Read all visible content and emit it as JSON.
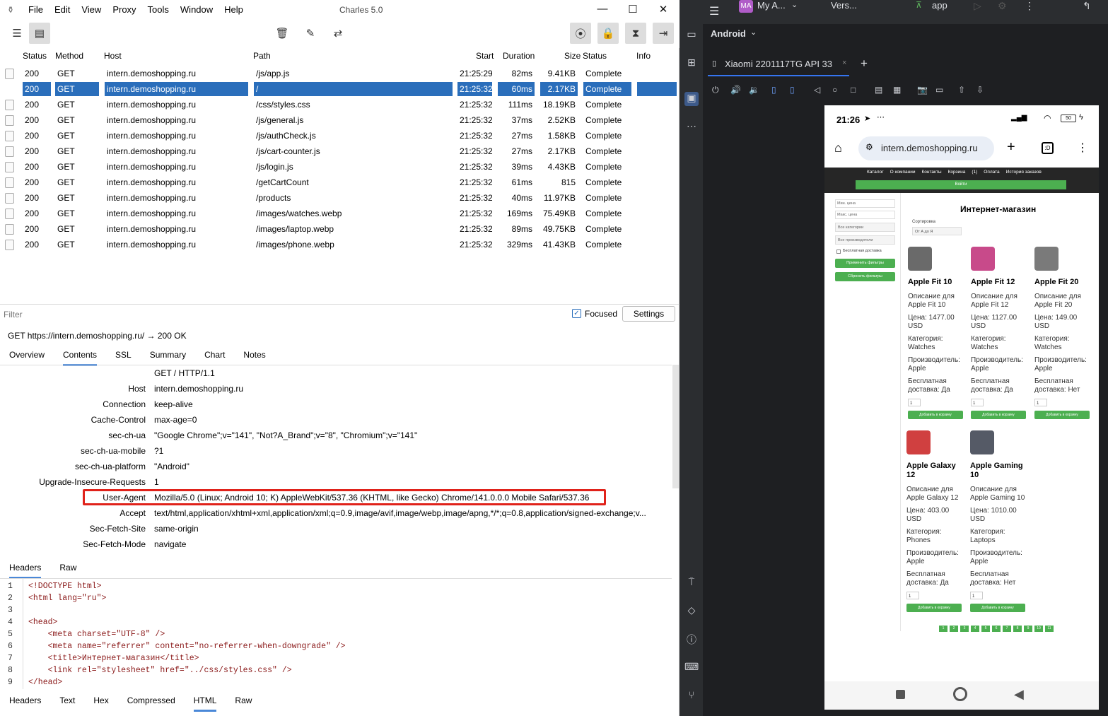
{
  "app": {
    "title": "Charles 5.0",
    "menus": [
      "File",
      "Edit",
      "View",
      "Proxy",
      "Tools",
      "Window",
      "Help"
    ]
  },
  "columns": [
    "Status",
    "Method",
    "Host",
    "Path",
    "Start",
    "Duration",
    "Size",
    "Status",
    "Info"
  ],
  "rows": [
    {
      "status": "200",
      "method": "GET",
      "host": "intern.demoshopping.ru",
      "path": "/js/app.js",
      "start": "21:25:29",
      "duration": "82ms",
      "size": "9.41KB",
      "state": "Complete",
      "icon": "js-file-icon"
    },
    {
      "status": "200",
      "method": "GET",
      "host": "intern.demoshopping.ru",
      "path": "/",
      "start": "21:25:32",
      "duration": "60ms",
      "size": "2.17KB",
      "state": "Complete",
      "icon": "html-file-icon",
      "selected": true
    },
    {
      "status": "200",
      "method": "GET",
      "host": "intern.demoshopping.ru",
      "path": "/css/styles.css",
      "start": "21:25:32",
      "duration": "111ms",
      "size": "18.19KB",
      "state": "Complete",
      "icon": "css-file-icon"
    },
    {
      "status": "200",
      "method": "GET",
      "host": "intern.demoshopping.ru",
      "path": "/js/general.js",
      "start": "21:25:32",
      "duration": "37ms",
      "size": "2.52KB",
      "state": "Complete",
      "icon": "js-file-icon"
    },
    {
      "status": "200",
      "method": "GET",
      "host": "intern.demoshopping.ru",
      "path": "/js/authCheck.js",
      "start": "21:25:32",
      "duration": "27ms",
      "size": "1.58KB",
      "state": "Complete",
      "icon": "js-file-icon"
    },
    {
      "status": "200",
      "method": "GET",
      "host": "intern.demoshopping.ru",
      "path": "/js/cart-counter.js",
      "start": "21:25:32",
      "duration": "27ms",
      "size": "2.17KB",
      "state": "Complete",
      "icon": "js-file-icon"
    },
    {
      "status": "200",
      "method": "GET",
      "host": "intern.demoshopping.ru",
      "path": "/js/login.js",
      "start": "21:25:32",
      "duration": "39ms",
      "size": "4.43KB",
      "state": "Complete",
      "icon": "js-file-icon"
    },
    {
      "status": "200",
      "method": "GET",
      "host": "intern.demoshopping.ru",
      "path": "/getCartCount",
      "start": "21:25:32",
      "duration": "61ms",
      "size": "815",
      "state": "Complete",
      "icon": "json-file-icon"
    },
    {
      "status": "200",
      "method": "GET",
      "host": "intern.demoshopping.ru",
      "path": "/products",
      "start": "21:25:32",
      "duration": "40ms",
      "size": "11.97KB",
      "state": "Complete",
      "icon": "json-file-icon"
    },
    {
      "status": "200",
      "method": "GET",
      "host": "intern.demoshopping.ru",
      "path": "/images/watches.webp",
      "start": "21:25:32",
      "duration": "169ms",
      "size": "75.49KB",
      "state": "Complete",
      "icon": "image-file-icon"
    },
    {
      "status": "200",
      "method": "GET",
      "host": "intern.demoshopping.ru",
      "path": "/images/laptop.webp",
      "start": "21:25:32",
      "duration": "89ms",
      "size": "49.75KB",
      "state": "Complete",
      "icon": "image-file-icon"
    },
    {
      "status": "200",
      "method": "GET",
      "host": "intern.demoshopping.ru",
      "path": "/images/phone.webp",
      "start": "21:25:32",
      "duration": "329ms",
      "size": "41.43KB",
      "state": "Complete",
      "icon": "image-file-icon"
    }
  ],
  "filter": {
    "placeholder": "Filter",
    "focused_label": "Focused",
    "settings_label": "Settings"
  },
  "request_line": "GET https://intern.demoshopping.ru/  → 200 OK",
  "detail_tabs": [
    "Overview",
    "Contents",
    "SSL",
    "Summary",
    "Chart",
    "Notes"
  ],
  "request_headers": [
    {
      "k": "",
      "v": "GET / HTTP/1.1"
    },
    {
      "k": "Host",
      "v": "intern.demoshopping.ru"
    },
    {
      "k": "Connection",
      "v": "keep-alive"
    },
    {
      "k": "Cache-Control",
      "v": "max-age=0"
    },
    {
      "k": "sec-ch-ua",
      "v": "\"Google Chrome\";v=\"141\", \"Not?A_Brand\";v=\"8\", \"Chromium\";v=\"141\""
    },
    {
      "k": "sec-ch-ua-mobile",
      "v": "?1"
    },
    {
      "k": "sec-ch-ua-platform",
      "v": "\"Android\""
    },
    {
      "k": "Upgrade-Insecure-Requests",
      "v": "1"
    },
    {
      "k": "User-Agent",
      "v": "Mozilla/5.0 (Linux; Android 10; K) AppleWebKit/537.36 (KHTML, like Gecko) Chrome/141.0.0.0 Mobile Safari/537.36"
    },
    {
      "k": "Accept",
      "v": "text/html,application/xhtml+xml,application/xml;q=0.9,image/avif,image/webp,image/apng,*/*;q=0.8,application/signed-exchange;v..."
    },
    {
      "k": "Sec-Fetch-Site",
      "v": "same-origin"
    },
    {
      "k": "Sec-Fetch-Mode",
      "v": "navigate"
    }
  ],
  "sub_tabs": [
    "Headers",
    "Raw"
  ],
  "code_lines": [
    "<!DOCTYPE html>",
    "<html lang=\"ru\">",
    "",
    "<head>",
    "    <meta charset=\"UTF-8\" />",
    "    <meta name=\"referrer\" content=\"no-referrer-when-downgrade\" />",
    "    <title>Интернет-магазин</title>",
    "    <link rel=\"stylesheet\" href=\"../css/styles.css\" />",
    "</head>"
  ],
  "bottom_tabs": [
    "Headers",
    "Text",
    "Hex",
    "Compressed",
    "HTML",
    "Raw"
  ],
  "studio": {
    "project": "My A...",
    "version": "Vers...",
    "run_config": "app",
    "android_label": "Android",
    "device_tab": "Xiaomi 2201117TG API 33",
    "project_badge": "MA"
  },
  "phone": {
    "time": "21:26",
    "battery": "50",
    "url": "intern.demoshopping.ru",
    "nav": [
      "Каталог",
      "О компании",
      "Контакты",
      "Корзина",
      "(1)",
      "Оплата",
      "История заказов"
    ],
    "login_btn": "Войти",
    "filters": {
      "min": "Мин. цена",
      "max": "Макс. цена",
      "cat": "Все категории",
      "man": "Все производители",
      "free": "Бесплатная доставка",
      "apply": "Применить фильтры",
      "reset": "Сбросить фильтры"
    },
    "heading": "Интернет-магазин",
    "sort_label": "Сортировка",
    "sort_value": "От А до Я",
    "products": [
      {
        "name": "Apple Fit 10",
        "desc": "Описание для Apple Fit 10",
        "price": "Цена: 1477.00 USD",
        "cat": "Категория: Watches",
        "man": "Производитель: Apple",
        "free": "Бесплатная доставка: Да",
        "color": "#6a6a6a"
      },
      {
        "name": "Apple Fit 12",
        "desc": "Описание для Apple Fit 12",
        "price": "Цена: 1127.00 USD",
        "cat": "Категория: Watches",
        "man": "Производитель: Apple",
        "free": "Бесплатная доставка: Да",
        "color": "#c84a8a"
      },
      {
        "name": "Apple Fit 20",
        "desc": "Описание для Apple Fit 20",
        "price": "Цена: 149.00 USD",
        "cat": "Категория: Watches",
        "man": "Производитель: Apple",
        "free": "Бесплатная доставка: Нет",
        "color": "#7a7a7a"
      },
      {
        "name": "Apple Galaxy 12",
        "desc": "Описание для Apple Galaxy 12",
        "price": "Цена: 403.00 USD",
        "cat": "Категория: Phones",
        "man": "Производитель: Apple",
        "free": "Бесплатная доставка: Да",
        "color": "#d04040"
      },
      {
        "name": "Apple Gaming 10",
        "desc": "Описание для Apple Gaming 10",
        "price": "Цена: 1010.00 USD",
        "cat": "Категория: Laptops",
        "man": "Производитель: Apple",
        "free": "Бесплатная доставка: Нет",
        "color": "#555a66"
      }
    ],
    "qty": "1",
    "add_btn": "Добавить в корзину",
    "pages": [
      "1",
      "2",
      "3",
      "4",
      "5",
      "6",
      "7",
      "8",
      "9",
      "10",
      "11"
    ]
  }
}
